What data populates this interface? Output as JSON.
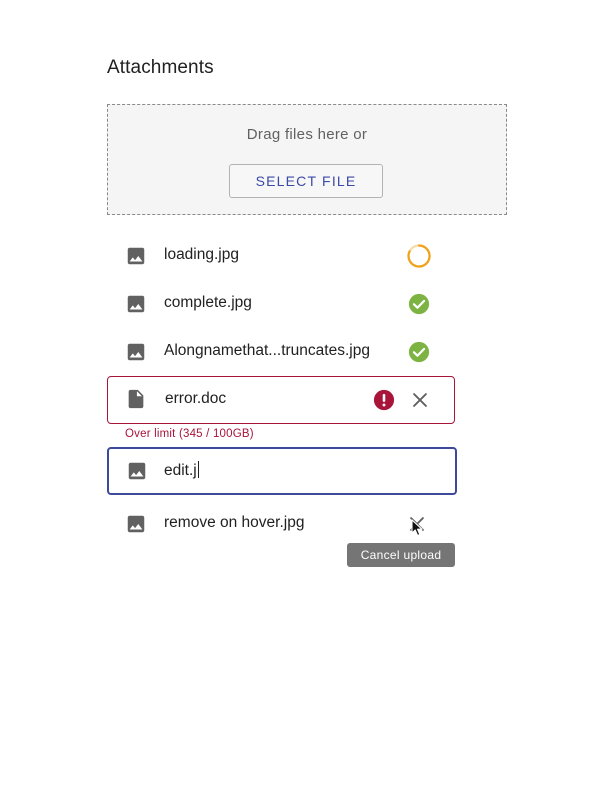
{
  "header": {
    "title": "Attachments"
  },
  "dropzone": {
    "prompt": "Drag files here or",
    "select_button_label": "SELECT FILE"
  },
  "files": [
    {
      "name": "loading.jpg",
      "file_type": "image-icon",
      "status": "loading",
      "status_icon": "spinner-icon"
    },
    {
      "name": "complete.jpg",
      "file_type": "image-icon",
      "status": "complete",
      "status_icon": "check-circle-icon"
    },
    {
      "name": "Alongnamethat...truncates.jpg",
      "file_type": "image-icon",
      "status": "complete",
      "status_icon": "check-circle-icon"
    },
    {
      "name": "error.doc",
      "file_type": "document-icon",
      "status": "error",
      "status_icon": "error-circle-icon",
      "action_icon": "close-icon",
      "error_message": "Over limit (345 / 100GB)"
    },
    {
      "name": "edit.j",
      "file_type": "image-icon",
      "status": "editing"
    },
    {
      "name": "remove on hover.jpg",
      "file_type": "image-icon",
      "status": "hover",
      "action_icon": "close-icon",
      "tooltip": "Cancel upload"
    }
  ],
  "colors": {
    "accent": "#3b4aa8",
    "error": "#a8143a",
    "success": "#7cb342",
    "loading": "#f0a21c",
    "icon_gray": "#616161"
  }
}
